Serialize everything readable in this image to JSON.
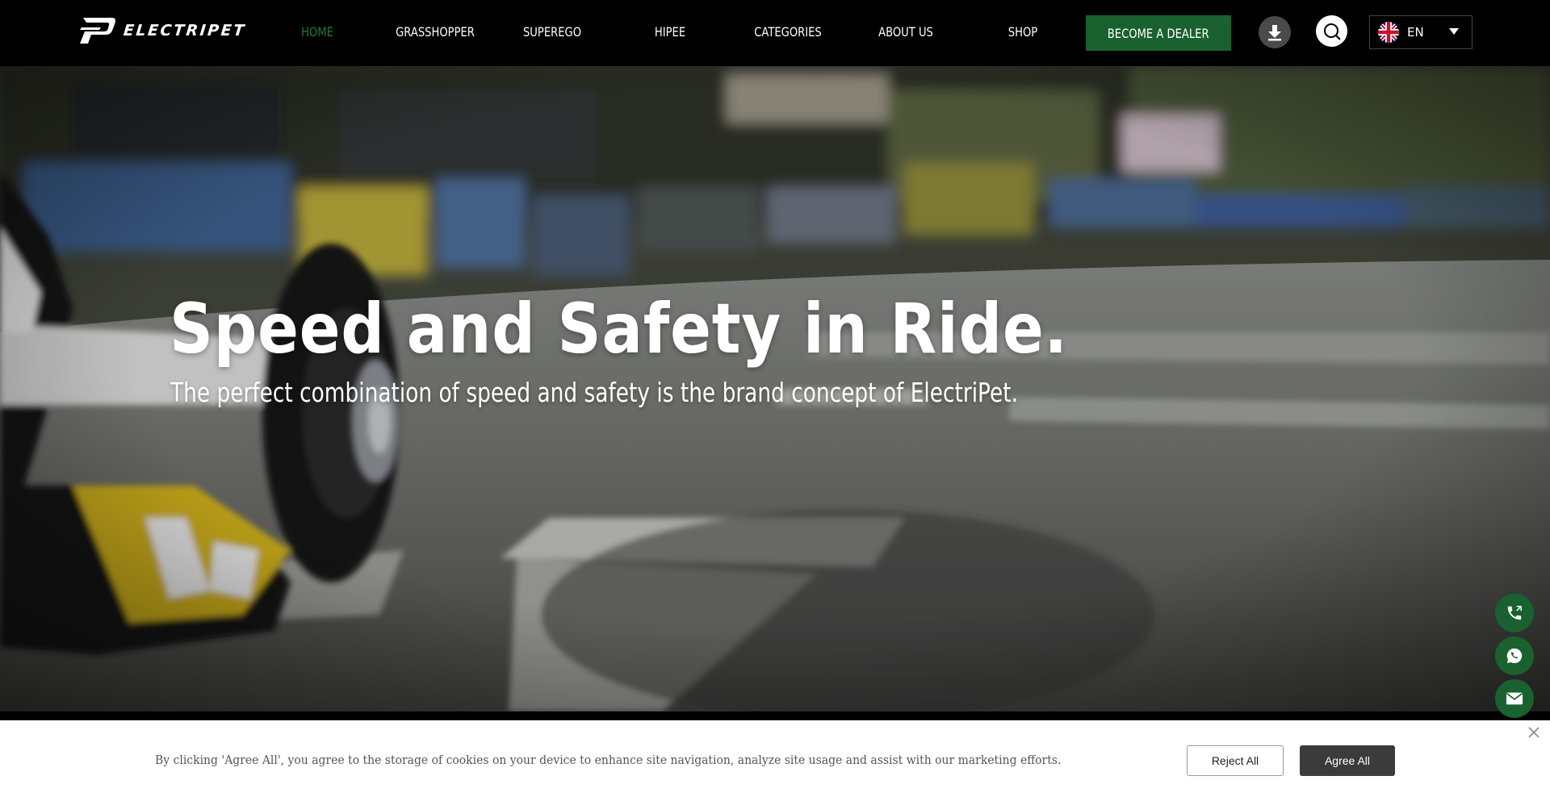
{
  "brand": {
    "name": "ELECTRIPET",
    "accent_color": "#19612e",
    "active_nav_color": "#1e7a3b"
  },
  "nav": {
    "items": [
      {
        "label": "HOME",
        "active": true
      },
      {
        "label": "GRASSHOPPER",
        "active": false
      },
      {
        "label": "SUPEREGO",
        "active": false
      },
      {
        "label": "HIPEE",
        "active": false
      },
      {
        "label": "CATEGORIES",
        "active": false
      },
      {
        "label": "ABOUT US",
        "active": false
      },
      {
        "label": "SHOP",
        "active": false
      }
    ],
    "dealer_button": "BECOME A DEALER",
    "download_icon": "download-icon",
    "search_icon": "search-icon",
    "language": {
      "selected": "EN",
      "flag_icon": "uk-flag-icon"
    }
  },
  "hero": {
    "title": "Speed and Safety in Ride.",
    "subtitle": "The perfect combination of speed and safety is the brand concept of ElectriPet."
  },
  "floating_contacts": [
    {
      "icon": "phone-icon"
    },
    {
      "icon": "whatsapp-icon"
    },
    {
      "icon": "mail-icon"
    }
  ],
  "cookie": {
    "text": "By clicking 'Agree All', you agree to the storage of cookies on your device to enhance site navigation, analyze site usage and assist with our marketing efforts.",
    "reject_label": "Reject All",
    "agree_label": "Agree All",
    "close_icon": "close-icon"
  }
}
